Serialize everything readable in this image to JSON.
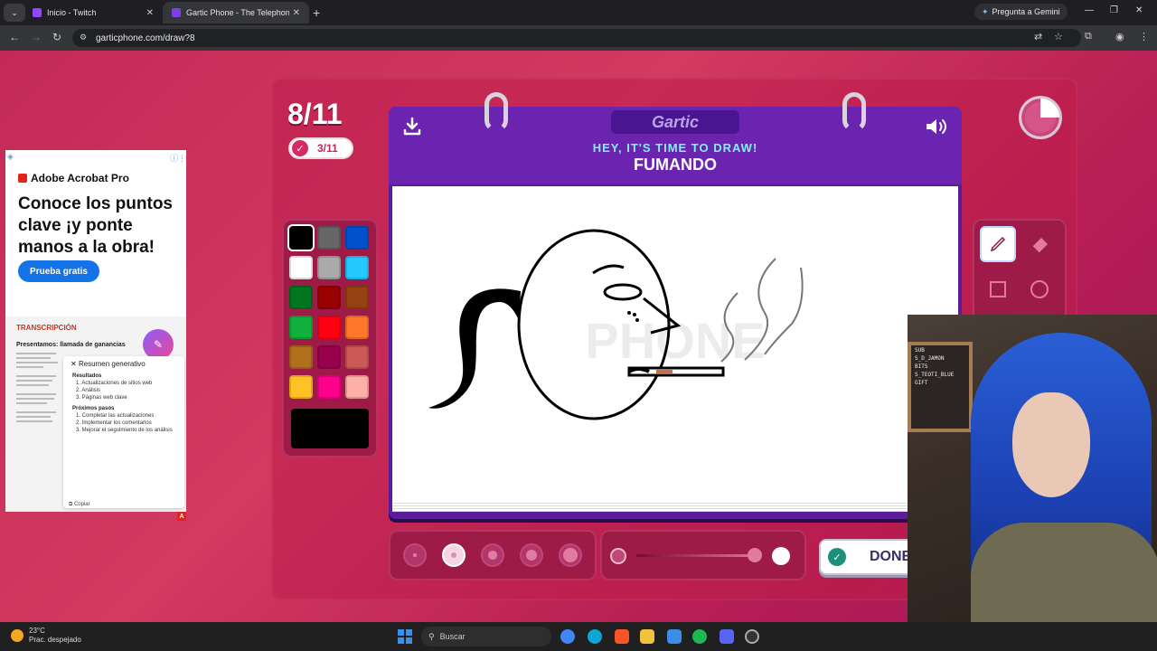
{
  "browser": {
    "tabs": [
      {
        "title": "Inicio - Twitch",
        "icon_color": "#9146ff",
        "active": false
      },
      {
        "title": "Gartic Phone - The Telephone G",
        "icon_color": "#7b3fe4",
        "active": true
      }
    ],
    "gemini_label": "Pregunta a Gemini",
    "url": "garticphone.com/draw?8",
    "window_controls": [
      "—",
      "❐",
      "✕"
    ]
  },
  "game": {
    "round": "8/11",
    "done_count": "3/11",
    "logo": "Gartic",
    "subtitle": "HEY, IT'S TIME TO DRAW!",
    "word": "FUMANDO",
    "timer_remaining_fraction": 0.75,
    "palette": [
      "#000000",
      "#666666",
      "#0050cd",
      "#ffffff",
      "#aaaaaa",
      "#26c9ff",
      "#017420",
      "#990000",
      "#964112",
      "#11b03c",
      "#ff0013",
      "#ff7829",
      "#b0701c",
      "#99004e",
      "#cb5a57",
      "#ffc126",
      "#ff008f",
      "#feafa8"
    ],
    "current_color": "#000000",
    "brush_sizes": [
      2,
      4,
      6,
      8,
      10
    ],
    "active_brush_size_index": 1,
    "opacity": 1.0,
    "tools": [
      "pen-icon",
      "eraser-icon",
      "square-outline-icon",
      "circle-outline-icon",
      "square-fill-icon",
      "circle-fill-icon"
    ],
    "active_tool": "pen-icon",
    "done_label": "DONE"
  },
  "ad": {
    "brand": "Adobe Acrobat Pro",
    "headline": "Conoce los puntos clave ¡y ponte manos a la obra!",
    "cta": "Prueba gratis",
    "section": "TRANSCRIPCIÓN",
    "doc_title": "Presentamos: llamada de ganancias",
    "panel_title": "Resumen generativo",
    "results_heading": "Resultados",
    "results": [
      "1. Actualizaciones de sitios web",
      "2. Análisis",
      "3. Páginas web clave"
    ],
    "next_heading": "Próximos pasos",
    "next_steps": [
      "1. Completar las actualizaciones",
      "2. Implementar los comentarios",
      "3. Mejorar el seguimiento de los análisis"
    ],
    "copy_label": "Copiar",
    "badge": "A"
  },
  "webcam": {
    "board_lines": [
      "SUB",
      "S_D_JAMON",
      "BITS",
      "S_TEOTI_BLUE",
      "GIFT"
    ]
  },
  "taskbar": {
    "temperature": "23°C",
    "weather_desc": "Prac. despejado",
    "search_placeholder": "Buscar"
  }
}
